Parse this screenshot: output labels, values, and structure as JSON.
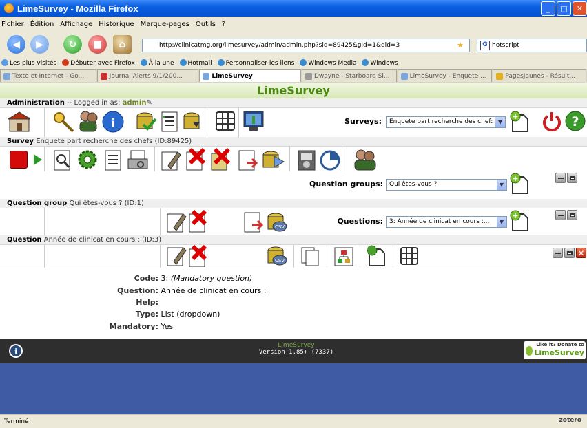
{
  "window": {
    "title": "LimeSurvey - Mozilla Firefox"
  },
  "menubar": [
    "Fichier",
    "Édition",
    "Affichage",
    "Historique",
    "Marque-pages",
    "Outils",
    "?"
  ],
  "navbar": {
    "url": "http://clinicatmg.org/limesurvey/admin/admin.php?sid=89425&gid=1&qid=3",
    "search": "hotscript"
  },
  "bookmarks": [
    "Les plus visités",
    "Débuter avec Firefox",
    "À la une",
    "Hotmail",
    "Personnaliser les liens",
    "Windows Media",
    "Windows"
  ],
  "tabs": [
    "Texte et Internet - Go...",
    "Journal Alerts 9/1/200...",
    "LimeSurvey",
    "Dwayne - Starboard Si...",
    "LimeSurvey - Enquete ...",
    "PagesJaunes - Résult..."
  ],
  "app_title": "LimeSurvey",
  "admin": {
    "label": "Administration",
    "logged_text": "-- Logged in as:",
    "user": "admin",
    "surveys_label": "Surveys:",
    "surveys_value": "Enquete part recherche des chef:"
  },
  "survey": {
    "label": "Survey",
    "name": "Enquete part recherche des chefs (ID:89425)",
    "groups_label": "Question groups:",
    "groups_value": "Qui êtes-vous ?"
  },
  "group": {
    "label": "Question group",
    "name": "Qui êtes-vous ? (ID:1)",
    "questions_label": "Questions:",
    "questions_value": "3: Année de clinicat en cours :..."
  },
  "question": {
    "label": "Question",
    "name": "Année de clinicat en cours : (ID:3)"
  },
  "details": {
    "code_label": "Code:",
    "code_value": "3:",
    "code_note": "(Mandatory question)",
    "question_label": "Question:",
    "question_value": "Année de clinicat en cours :",
    "help_label": "Help:",
    "type_label": "Type:",
    "type_value": "List (dropdown)",
    "mandatory_label": "Mandatory:",
    "mandatory_value": "Yes"
  },
  "footer": {
    "name": "LimeSurvey",
    "version": "Version 1.85+ (7337)",
    "donate_top": "Like it? Donate to",
    "donate_brand": "LimeSurvey"
  },
  "statusbar": {
    "text": "Terminé",
    "addon": "zotero"
  }
}
